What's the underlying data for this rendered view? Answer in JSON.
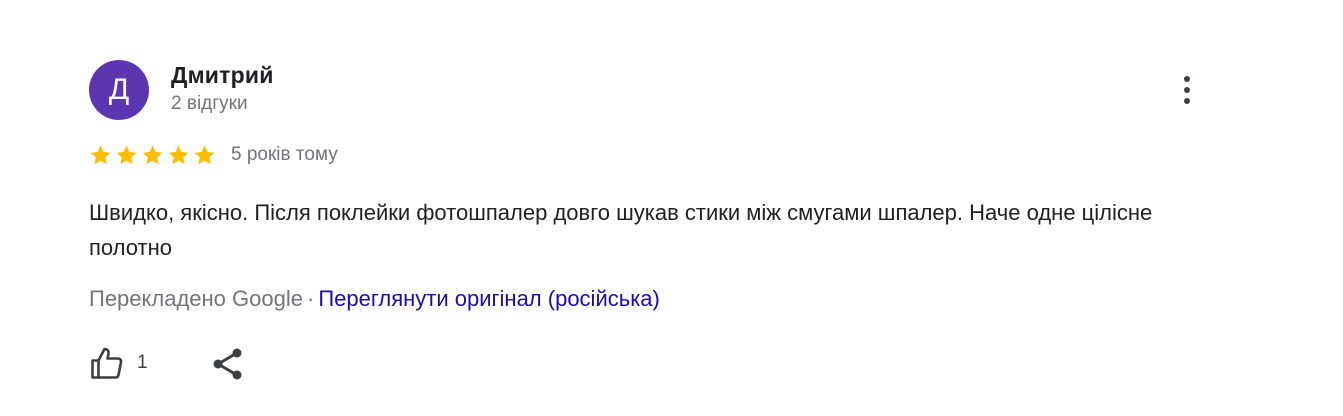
{
  "review": {
    "avatar_letter": "Д",
    "avatar_color": "#5e35b1",
    "reviewer_name": "Дмитрий",
    "review_count": "2 відгуки",
    "rating": 5,
    "rating_max": 5,
    "time_ago": "5 років тому",
    "text": "Швидко, якісно. Після поклейки фотошпалер довго шукав стики між смугами шпалер. Наче одне цілісне полотно",
    "translated_by": "Перекладено Google",
    "separator": "·",
    "view_original": "Переглянути оригінал (російська)",
    "like_count": "1"
  },
  "icons": {
    "more": "more-vert-icon",
    "star": "star-icon",
    "like": "thumb-up-icon",
    "share": "share-icon"
  },
  "colors": {
    "star": "#fbbc04",
    "link": "#1a0dab",
    "secondary_text": "#70757a",
    "primary_text": "#202124"
  }
}
